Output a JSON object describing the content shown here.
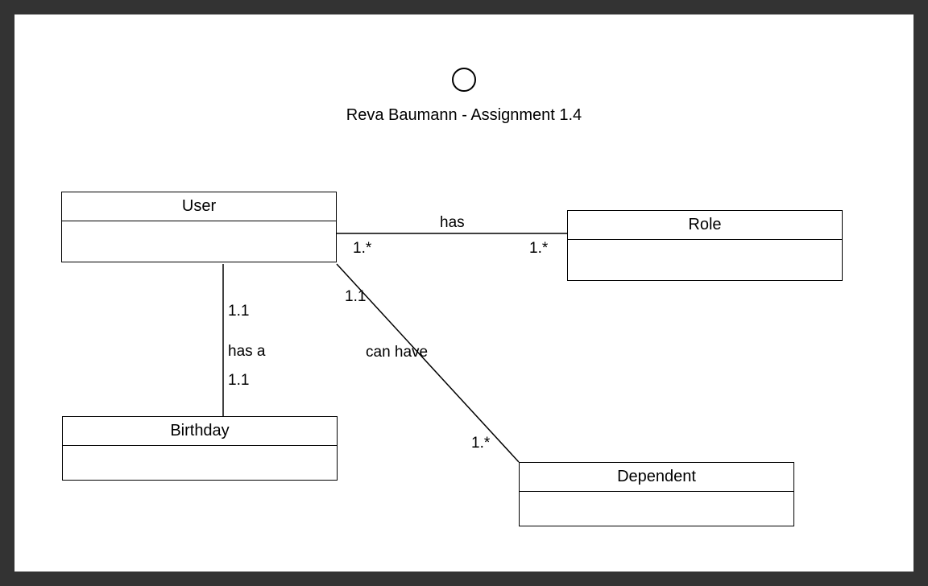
{
  "title": "Reva Baumann - Assignment 1.4",
  "entities": {
    "user": "User",
    "role": "Role",
    "birthday": "Birthday",
    "dependent": "Dependent"
  },
  "relationships": {
    "user_role": {
      "label": "has",
      "mult_left": "1.*",
      "mult_right": "1.*"
    },
    "user_birthday": {
      "label": "has a",
      "mult_top": "1.1",
      "mult_bottom": "1.1"
    },
    "user_dependent": {
      "label": "can have",
      "mult_top": "1.1",
      "mult_bottom": "1.*"
    }
  }
}
